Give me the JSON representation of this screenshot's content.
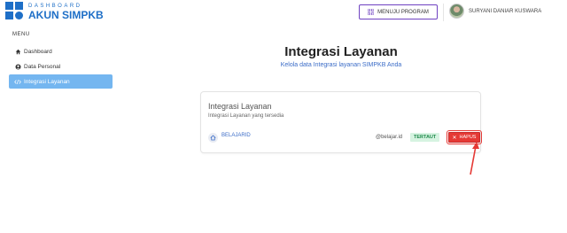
{
  "header": {
    "logo_sub": "DASHBOARD",
    "logo_main": "AKUN SIMPKB",
    "menu_program_label": "MENUJU PROGRAM",
    "user_name": "SURYANI DANIAR KUSWARA"
  },
  "sidebar": {
    "title": "MENU",
    "items": [
      {
        "label": "Dashboard",
        "icon": "home-icon",
        "active": false
      },
      {
        "label": "Data Personal",
        "icon": "user-icon",
        "active": false
      },
      {
        "label": "Integrasi Layanan",
        "icon": "code-icon",
        "active": true
      }
    ]
  },
  "main": {
    "title": "Integrasi Layanan",
    "subtitle": "Kelola data Integrasi layanan SIMPKB Anda",
    "card": {
      "title": "Integrasi Layanan",
      "subtitle": "Integrasi Layanan yang tersedia",
      "services": [
        {
          "name": "BELAJARID",
          "account": "@belajar.id",
          "status": "TERTAUT",
          "action_label": "HAPUS"
        }
      ]
    }
  },
  "colors": {
    "brand": "#1e6fc7",
    "active_nav": "#74b6f0",
    "accent_purple": "#6f42c1",
    "danger": "#e53935",
    "success_bg": "#d6f3e1",
    "success_text": "#1e8a4a"
  }
}
